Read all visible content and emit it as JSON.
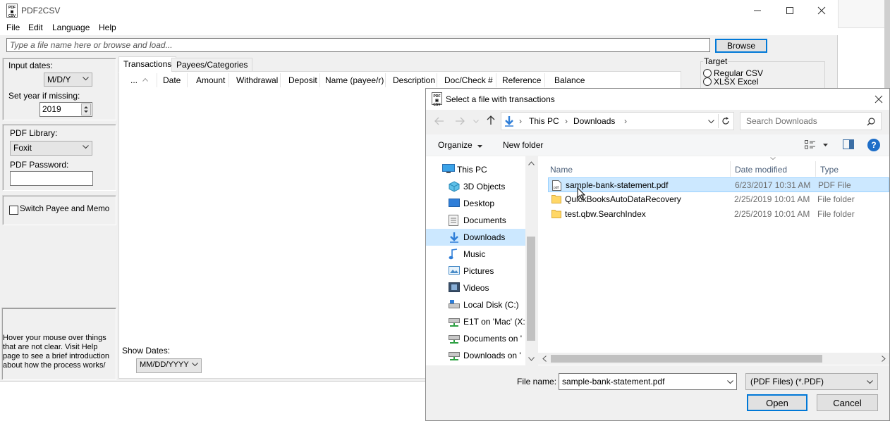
{
  "app": {
    "title": "PDF2CSV",
    "icon_label": "PDF CSV",
    "menu": [
      "File",
      "Edit",
      "Language",
      "Help"
    ],
    "file_input_placeholder": "Type a file name here or browse and load...",
    "browse_label": "Browse"
  },
  "settings": {
    "input_dates_label": "Input dates:",
    "input_dates_value": "M/D/Y",
    "year_label": "Set year if missing:",
    "year_value": "2019",
    "pdf_library_label": "PDF Library:",
    "pdf_library_value": "Foxit",
    "pdf_password_label": "PDF Password:",
    "switch_label": "Switch Payee and Memo",
    "help_text": "Hover your mouse over things that are not clear. Visit Help page to see a brief introduction about how the process works/"
  },
  "tabs": [
    "Transactions",
    "Payees/Categories"
  ],
  "columns": [
    "...",
    "Date",
    "Amount",
    "Withdrawal",
    "Deposit",
    "Name (payee/r)",
    "Description",
    "Doc/Check #",
    "Reference",
    "Balance"
  ],
  "show_dates_label": "Show Dates:",
  "show_dates_value": "MM/DD/YYYY",
  "target": {
    "label": "Target",
    "options": [
      "Regular CSV",
      "XLSX Excel"
    ]
  },
  "dialog": {
    "title": "Select a file with transactions",
    "breadcrumb": [
      "This PC",
      "Downloads"
    ],
    "search_placeholder": "Search Downloads",
    "organize_label": "Organize",
    "new_folder_label": "New folder",
    "nav_items": [
      {
        "label": "This PC",
        "icon": "pc-icon"
      },
      {
        "label": "3D Objects",
        "icon": "3d-objects-icon"
      },
      {
        "label": "Desktop",
        "icon": "desktop-icon"
      },
      {
        "label": "Documents",
        "icon": "documents-icon"
      },
      {
        "label": "Downloads",
        "icon": "downloads-icon"
      },
      {
        "label": "Music",
        "icon": "music-icon"
      },
      {
        "label": "Pictures",
        "icon": "pictures-icon"
      },
      {
        "label": "Videos",
        "icon": "videos-icon"
      },
      {
        "label": "Local Disk (C:)",
        "icon": "disk-icon"
      },
      {
        "label": "E1T on 'Mac' (X:",
        "icon": "network-drive-icon"
      },
      {
        "label": "Documents on '",
        "icon": "network-drive-icon"
      },
      {
        "label": "Downloads on '",
        "icon": "network-drive-icon"
      }
    ],
    "columns": [
      "Name",
      "Date modified",
      "Type"
    ],
    "files": [
      {
        "name": "sample-bank-statement.pdf",
        "date": "6/23/2017 10:31 AM",
        "type": "PDF File",
        "icon": "pdf-file-icon"
      },
      {
        "name": "QuickBooksAutoDataRecovery",
        "date": "2/25/2019 10:01 AM",
        "type": "File folder",
        "icon": "folder-icon"
      },
      {
        "name": "test.qbw.SearchIndex",
        "date": "2/25/2019 10:01 AM",
        "type": "File folder",
        "icon": "folder-icon"
      }
    ],
    "file_name_label": "File name:",
    "file_name_value": "sample-bank-statement.pdf",
    "filter_value": "(PDF Files) (*.PDF)",
    "open_label": "Open",
    "cancel_label": "Cancel"
  },
  "colors": {
    "selection": "#cce8ff",
    "accent": "#0078d7",
    "folder": "#ffd767"
  }
}
